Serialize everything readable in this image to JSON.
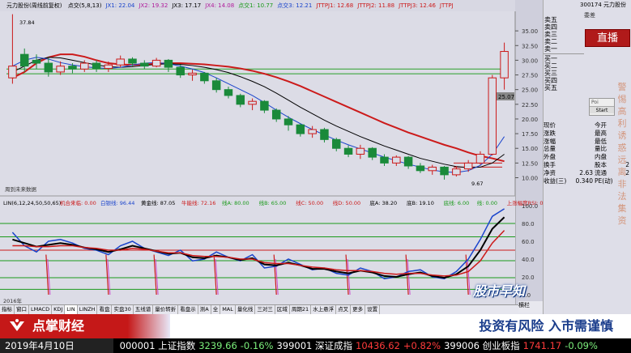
{
  "top_bar": {
    "stock_name": "元力股份(周线前复权)",
    "indicators": [
      {
        "label": "点交(5,8,13)",
        "color": "#000000"
      },
      {
        "label": "JX1: 22.04",
        "color": "#1a44cc"
      },
      {
        "label": "JX2: 19.32",
        "color": "#b01a9a"
      },
      {
        "label": "JX3: 17.17",
        "color": "#000000"
      },
      {
        "label": "JX4: 14.08",
        "color": "#b01a9a"
      },
      {
        "label": "点交1: 10.77",
        "color": "#1a9a1a"
      },
      {
        "label": "点交3: 12.21",
        "color": "#1a44cc"
      },
      {
        "label": "JTTPJ1: 12.68",
        "color": "#cc1a1a"
      },
      {
        "label": "JTTPJ2: 11.88",
        "color": "#cc1a1a"
      },
      {
        "label": "JTTPJ3: 12.46",
        "color": "#cc1a1a"
      },
      {
        "label": "JTTPJ",
        "color": "#cc1a1a"
      }
    ]
  },
  "price_axis": [
    "35.00",
    "32.50",
    "30.00",
    "27.50",
    "25.00",
    "22.50",
    "20.00",
    "17.50",
    "15.00",
    "12.50",
    "10.00"
  ],
  "price_labels": {
    "high": "37.84",
    "low": "9.67",
    "current": "25.07"
  },
  "chart_note": "周到未来数据",
  "sub_indicator": {
    "label": "LIN(6,12,24,50,50,65)",
    "items": [
      {
        "label": "机合来临: 0.00",
        "color": "#cc1a1a"
      },
      {
        "label": "白银线: 96.44",
        "color": "#1a44cc"
      },
      {
        "label": "黄金线: 87.05",
        "color": "#000000"
      },
      {
        "label": "牛能线: 72.16",
        "color": "#cc1a1a"
      },
      {
        "label": "线A: 80.00",
        "color": "#1a9a1a"
      },
      {
        "label": "线B: 65.00",
        "color": "#1a9a1a"
      },
      {
        "label": "线C: 50.00",
        "color": "#cc1a1a"
      },
      {
        "label": "线D: 50.00",
        "color": "#cc1a1a"
      },
      {
        "label": "底A: 38.20",
        "color": "#000000"
      },
      {
        "label": "底B: 19.10",
        "color": "#000000"
      },
      {
        "label": "底线: 6.00",
        "color": "#1a9a1a"
      },
      {
        "label": "线: 0.00",
        "color": "#1a9a1a"
      },
      {
        "label": "上涨幅度RSI: 0.00",
        "color": "#cc1a1a"
      }
    ]
  },
  "sub_axis": [
    "100.0",
    "80.0",
    "60.0",
    "40.0",
    "20.0",
    "0.0"
  ],
  "date_label": "2016年",
  "bottom_tabs": [
    "指标",
    "窗口",
    "LMACD",
    "KDJ",
    "LIN",
    "LINZH",
    "看盘",
    "实盘30",
    "五线谱",
    "量价转折",
    "看盘示",
    "测A",
    "全",
    "MAL",
    "量化线",
    "三对三",
    "区域",
    "周期21",
    "水上悬浮",
    "点叉",
    "更多",
    "设置"
  ],
  "active_tab": "LIN",
  "scroll_label": "横栏",
  "order_book": {
    "code_name": "300174 元力股份",
    "commission": "委差",
    "sell_rows": [
      "卖五",
      "卖四",
      "卖三",
      "卖二",
      "卖一"
    ],
    "buy_rows": [
      "买一",
      "买二",
      "买三",
      "买四",
      "买五"
    ]
  },
  "live_badge": "直播",
  "warning_chars": [
    "警",
    "惕",
    "高",
    "利",
    "诱",
    "惑",
    "远",
    "离",
    "非",
    "法",
    "集",
    "资"
  ],
  "popup": {
    "line1": "Poi",
    "line2": "Start"
  },
  "stats": [
    {
      "l1": "现价",
      "v1": "",
      "l2": "今开",
      "v2": ""
    },
    {
      "l1": "涨跌",
      "v1": "",
      "l2": "最高",
      "v2": ""
    },
    {
      "l1": "涨幅",
      "v1": "",
      "l2": "最低",
      "v2": ""
    },
    {
      "l1": "总量",
      "v1": "",
      "l2": "量比",
      "v2": ""
    },
    {
      "l1": "外盘",
      "v1": "",
      "l2": "内盘",
      "v2": ""
    },
    {
      "l1": "换手",
      "v1": "",
      "l2": "股本",
      "v2": "2"
    },
    {
      "l1": "净资",
      "v1": "2.63",
      "l2": "流通",
      "v2": "2"
    },
    {
      "l1": "收益(三)",
      "v1": "0.340",
      "l2": "PE(动)",
      "v2": ""
    }
  ],
  "watermark_logo": "股市早知",
  "footer": {
    "brand": "点掌财经",
    "risk_warning": "投资有风险  入市需谨慎"
  },
  "ticker": {
    "date": "2019年4月10日",
    "items": [
      {
        "text": "000001 上证指数",
        "cls": ""
      },
      {
        "text": "3239.66",
        "cls": "ok"
      },
      {
        "text": "-0.16%",
        "cls": "neg"
      },
      {
        "text": "399001 深证成指",
        "cls": ""
      },
      {
        "text": "10436.62",
        "cls": "pos"
      },
      {
        "text": "+0.82%",
        "cls": "pos"
      },
      {
        "text": "399006 创业板指",
        "cls": ""
      },
      {
        "text": "1741.17",
        "cls": "pos"
      },
      {
        "text": "-0.09%",
        "cls": "neg"
      }
    ]
  },
  "colors": {
    "up": "#cc1a1a",
    "down": "#1a8a3a",
    "ma_red": "#cc1a1a",
    "ma_black": "#000000",
    "brand_red": "#c51818"
  },
  "chart_data": {
    "type": "candlestick",
    "price_ylim": [
      8,
      37.5
    ],
    "ma_lines": [
      {
        "name": "red",
        "color": "#cc1a1a",
        "values": [
          27,
          28,
          29.5,
          30.5,
          31,
          31,
          30.6,
          30,
          29.5,
          29.3,
          29.2,
          29.3,
          29.4,
          29.5,
          29.5,
          29.4,
          29.3,
          29.1,
          28.9,
          28.6,
          28.2,
          27.7,
          27.1,
          26.4,
          25.6,
          24.7,
          23.8,
          22.9,
          22,
          21.1,
          20.2,
          19.3,
          18.5,
          17.7,
          17,
          16.3,
          15.6,
          15,
          14.3,
          13.7,
          13.3,
          12.8
        ]
      },
      {
        "name": "black",
        "color": "#000000",
        "values": [
          28,
          29,
          30,
          30.5,
          30.4,
          30,
          29.6,
          29.2,
          28.9,
          28.8,
          28.9,
          29.1,
          29.3,
          29.4,
          29.3,
          29.1,
          28.8,
          28.4,
          27.9,
          27.2,
          26.4,
          25.5,
          24.4,
          23.2,
          22,
          20.9,
          19.8,
          18.8,
          17.9,
          17,
          16.2,
          15.4,
          14.7,
          14,
          13.3,
          12.8,
          12.3,
          11.9,
          11.7,
          11.8,
          12.5,
          14
        ]
      },
      {
        "name": "blue",
        "color": "#1a44cc",
        "values": [
          29,
          30,
          30.5,
          30.2,
          29.6,
          29.2,
          28.9,
          28.7,
          28.6,
          28.8,
          29.2,
          29.5,
          29.6,
          29.4,
          29,
          28.5,
          27.9,
          27,
          26,
          25,
          24,
          22.8,
          21.5,
          20.3,
          19.2,
          18.2,
          17.3,
          16.4,
          15.6,
          14.9,
          14.2,
          13.5,
          12.9,
          12.3,
          11.8,
          11.3,
          11,
          10.9,
          11.2,
          12.1,
          14,
          17
        ]
      }
    ],
    "candles": [
      {
        "o": 27,
        "c": 29,
        "h": 37.84,
        "l": 26
      },
      {
        "o": 31,
        "c": 29,
        "h": 32,
        "l": 28
      },
      {
        "o": 30,
        "c": 29.5,
        "h": 31,
        "l": 28.5
      },
      {
        "o": 29.5,
        "c": 28,
        "h": 30.5,
        "l": 27.2
      },
      {
        "o": 28,
        "c": 29,
        "h": 29.8,
        "l": 27.5
      },
      {
        "o": 29,
        "c": 28.5,
        "h": 29.5,
        "l": 27.8
      },
      {
        "o": 28.5,
        "c": 29.5,
        "h": 30,
        "l": 28
      },
      {
        "o": 29.5,
        "c": 28.6,
        "h": 30,
        "l": 28
      },
      {
        "o": 28.6,
        "c": 29.2,
        "h": 29.8,
        "l": 28
      },
      {
        "o": 29.2,
        "c": 30.2,
        "h": 30.8,
        "l": 28.8
      },
      {
        "o": 30.2,
        "c": 29.5,
        "h": 30.5,
        "l": 29
      },
      {
        "o": 29.5,
        "c": 29,
        "h": 30,
        "l": 28.5
      },
      {
        "o": 29,
        "c": 30,
        "h": 30.4,
        "l": 28.8
      },
      {
        "o": 30,
        "c": 28.8,
        "h": 30.2,
        "l": 28
      },
      {
        "o": 28.8,
        "c": 27.5,
        "h": 29.2,
        "l": 27
      },
      {
        "o": 27.5,
        "c": 27.8,
        "h": 28.4,
        "l": 26.5
      },
      {
        "o": 27.8,
        "c": 26.5,
        "h": 28,
        "l": 26
      },
      {
        "o": 26.5,
        "c": 25,
        "h": 27,
        "l": 24.5
      },
      {
        "o": 25,
        "c": 24,
        "h": 25.5,
        "l": 23.5
      },
      {
        "o": 24,
        "c": 22.5,
        "h": 24.3,
        "l": 22
      },
      {
        "o": 22.5,
        "c": 23,
        "h": 23.5,
        "l": 21.5
      },
      {
        "o": 23,
        "c": 21.5,
        "h": 23.2,
        "l": 21
      },
      {
        "o": 21.5,
        "c": 20,
        "h": 21.8,
        "l": 19.5
      },
      {
        "o": 20,
        "c": 19,
        "h": 20.5,
        "l": 18
      },
      {
        "o": 19,
        "c": 17.5,
        "h": 19.2,
        "l": 17
      },
      {
        "o": 17.5,
        "c": 18.2,
        "h": 18.8,
        "l": 16.8
      },
      {
        "o": 18.2,
        "c": 16.5,
        "h": 18.5,
        "l": 16
      },
      {
        "o": 16.5,
        "c": 15,
        "h": 16.8,
        "l": 14.5
      },
      {
        "o": 15,
        "c": 14,
        "h": 15.5,
        "l": 13.5
      },
      {
        "o": 14,
        "c": 15,
        "h": 15.6,
        "l": 13.2
      },
      {
        "o": 15,
        "c": 13.5,
        "h": 15.2,
        "l": 13
      },
      {
        "o": 13.5,
        "c": 12.5,
        "h": 14,
        "l": 12
      },
      {
        "o": 12.5,
        "c": 13.5,
        "h": 13.8,
        "l": 12
      },
      {
        "o": 13.5,
        "c": 12,
        "h": 13.7,
        "l": 11.5
      },
      {
        "o": 12,
        "c": 11.2,
        "h": 12.5,
        "l": 10.8
      },
      {
        "o": 11.2,
        "c": 11.8,
        "h": 12.2,
        "l": 10.5
      },
      {
        "o": 11.8,
        "c": 10.5,
        "h": 12,
        "l": 9.67
      },
      {
        "o": 10.5,
        "c": 11.5,
        "h": 12,
        "l": 10.2
      },
      {
        "o": 11.5,
        "c": 12.5,
        "h": 13,
        "l": 11
      },
      {
        "o": 12.5,
        "c": 14,
        "h": 14.5,
        "l": 12.2
      },
      {
        "o": 14,
        "c": 27,
        "h": 27.5,
        "l": 13.8
      },
      {
        "o": 27,
        "c": 31.5,
        "h": 33,
        "l": 25
      }
    ],
    "sub_ylim": [
      0,
      100
    ],
    "sub_lines": [
      {
        "name": "白银线",
        "color": "#1a44cc",
        "values": [
          70,
          55,
          48,
          60,
          62,
          58,
          52,
          50,
          45,
          55,
          60,
          52,
          48,
          44,
          50,
          38,
          40,
          48,
          42,
          38,
          45,
          30,
          32,
          40,
          34,
          28,
          30,
          24,
          22,
          30,
          26,
          18,
          20,
          26,
          28,
          20,
          18,
          26,
          40,
          62,
          88,
          96.44
        ]
      },
      {
        "name": "黄金线",
        "color": "#000000",
        "values": [
          62,
          58,
          54,
          56,
          58,
          56,
          53,
          51,
          48,
          51,
          55,
          52,
          49,
          46,
          47,
          42,
          41,
          44,
          42,
          39,
          41,
          34,
          33,
          36,
          33,
          29,
          29,
          26,
          24,
          27,
          25,
          21,
          20,
          23,
          25,
          21,
          19,
          23,
          32,
          50,
          74,
          87.05
        ]
      },
      {
        "name": "牛能线",
        "color": "#cc1a1a",
        "values": [
          55,
          55,
          54,
          54,
          55,
          55,
          53,
          52,
          50,
          50,
          52,
          51,
          49,
          47,
          47,
          44,
          43,
          43,
          42,
          40,
          40,
          36,
          35,
          35,
          33,
          31,
          30,
          28,
          27,
          27,
          26,
          24,
          23,
          24,
          24,
          22,
          21,
          22,
          26,
          38,
          58,
          72.16
        ]
      }
    ],
    "sub_hlines": [
      {
        "value": 80,
        "color": "#1a9a1a"
      },
      {
        "value": 65,
        "color": "#1a9a1a"
      },
      {
        "value": 50,
        "color": "#cc1a1a"
      },
      {
        "value": 38.2,
        "color": "#1a9a1a"
      },
      {
        "value": 19.1,
        "color": "#1a9a1a"
      },
      {
        "value": 6,
        "color": "#1a9a1a"
      }
    ],
    "signal_bars": [
      3,
      8,
      12,
      17,
      22,
      28,
      33,
      38
    ]
  }
}
